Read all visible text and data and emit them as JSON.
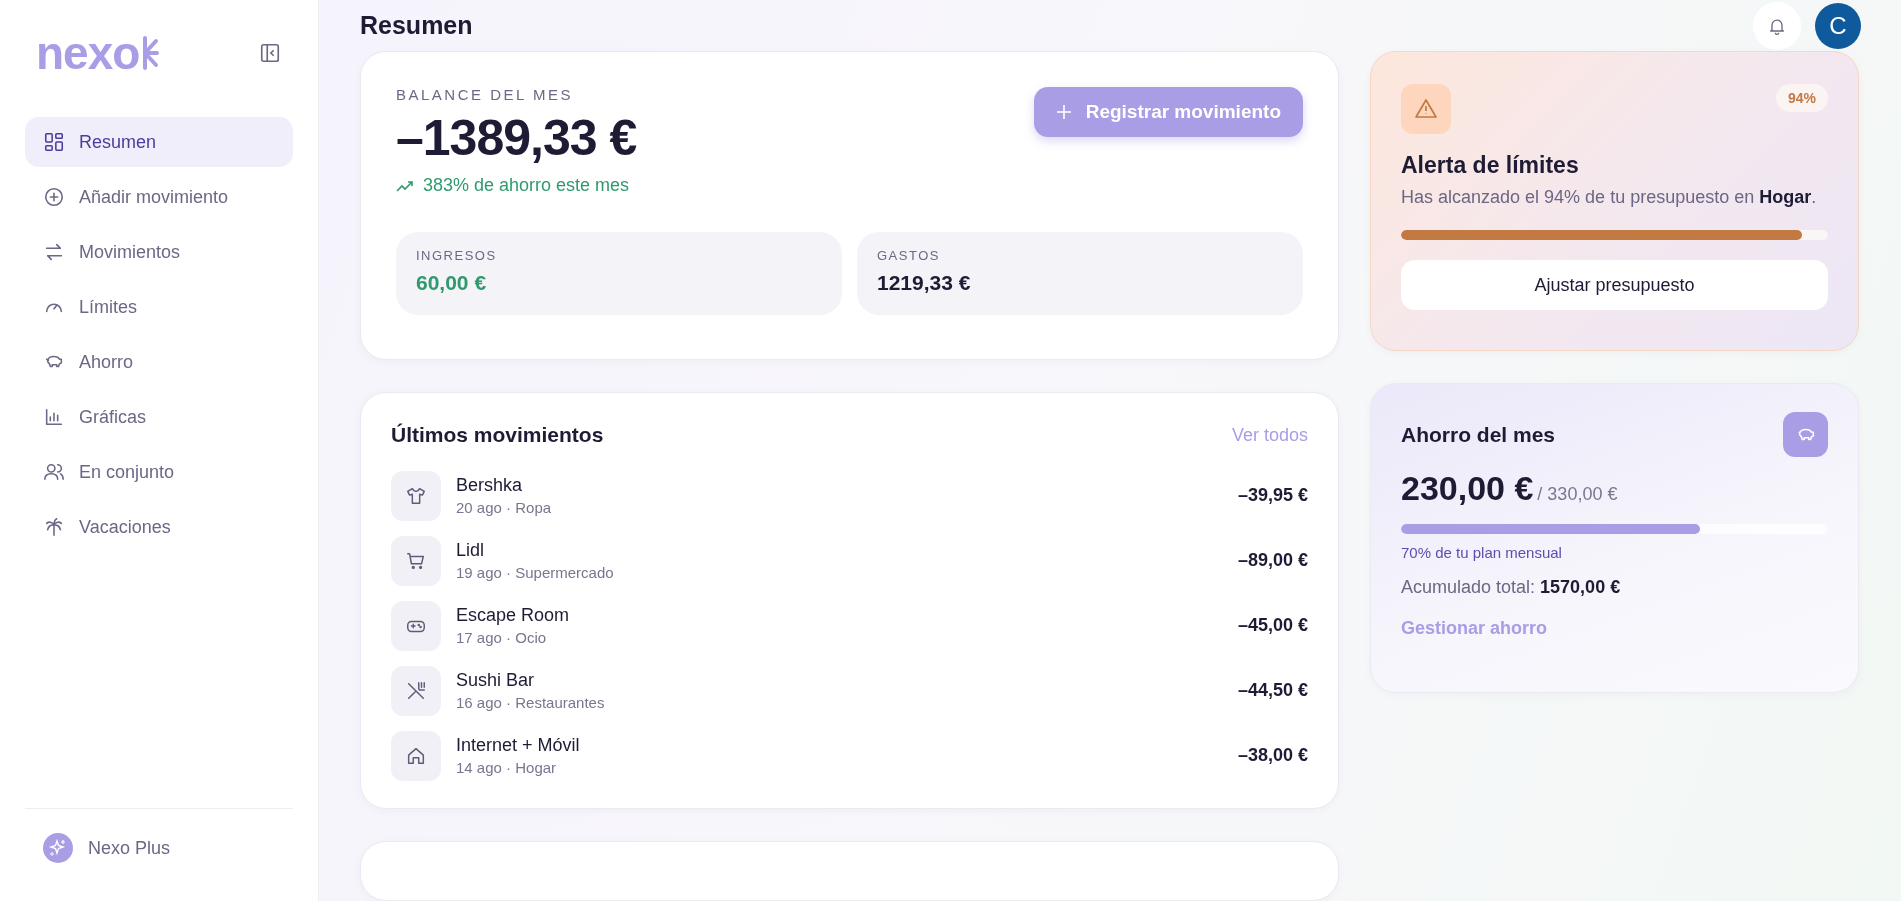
{
  "logo": {
    "text": "nexo"
  },
  "sidebar": {
    "items": [
      {
        "label": "Resumen",
        "selected": true
      },
      {
        "label": "Añadir movimiento",
        "selected": false
      },
      {
        "label": "Movimientos",
        "selected": false
      },
      {
        "label": "Límites",
        "selected": false
      },
      {
        "label": "Ahorro",
        "selected": false
      },
      {
        "label": "Gráficas",
        "selected": false
      },
      {
        "label": "En conjunto",
        "selected": false
      },
      {
        "label": "Vacaciones",
        "selected": false
      }
    ],
    "footer": {
      "label": "Nexo Plus"
    }
  },
  "header": {
    "title": "Resumen",
    "avatar": "C"
  },
  "balance": {
    "label": "BALANCE DEL MES",
    "amount": "–1389,33 €",
    "trend": "383% de ahorro este mes",
    "button": "Registrar movimiento",
    "stats": [
      {
        "label": "INGRESOS",
        "value": "60,00 €",
        "kind": "income"
      },
      {
        "label": "GASTOS",
        "value": "1219,33 €",
        "kind": "expense"
      }
    ]
  },
  "movements": {
    "title": "Últimos movimientos",
    "link": "Ver todos",
    "rows": [
      {
        "name": "Bershka",
        "meta": "20 ago · Ropa",
        "amount": "–39,95 €"
      },
      {
        "name": "Lidl",
        "meta": "19 ago · Supermercado",
        "amount": "–89,00 €"
      },
      {
        "name": "Escape Room",
        "meta": "17 ago · Ocio",
        "amount": "–45,00 €"
      },
      {
        "name": "Sushi Bar",
        "meta": "16 ago · Restaurantes",
        "amount": "–44,50 €"
      },
      {
        "name": "Internet + Móvil",
        "meta": "14 ago · Hogar",
        "amount": "–38,00 €"
      }
    ]
  },
  "alert": {
    "badge": "94%",
    "title": "Alerta de límites",
    "message": "Has alcanzado el 94% de tu presupuesto en **Hogar**.",
    "level": 0.94,
    "button": "Ajustar presupuesto"
  },
  "savings": {
    "title": "Ahorro del mes",
    "amount": "230,00 €",
    "target": "/ 330,00 €",
    "level": 0.7,
    "plan": "70% de tu plan mensual",
    "total_label": "Acumulado total:",
    "total_value": "1570,00 €",
    "link": "Gestionar ahorro"
  }
}
